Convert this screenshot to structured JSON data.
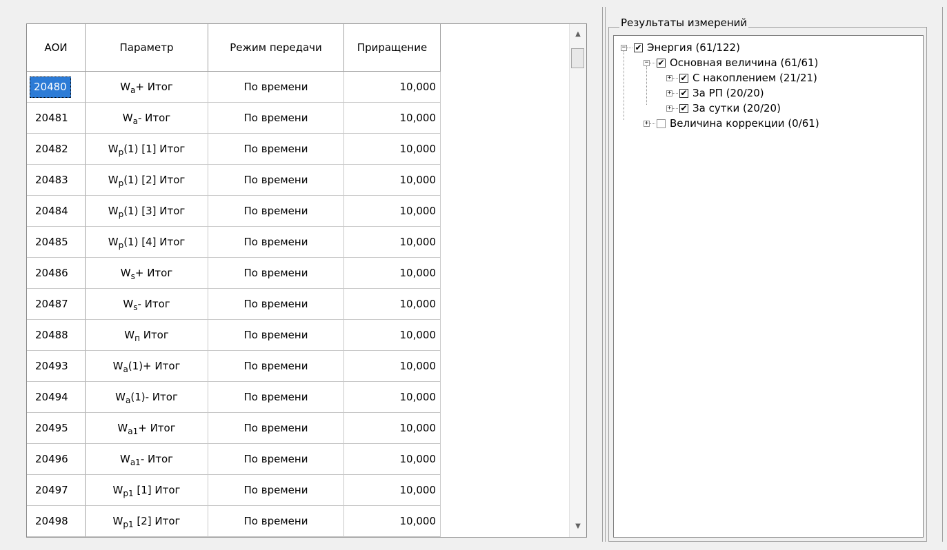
{
  "grid": {
    "headers": {
      "aoi": "АОИ",
      "param": "Параметр",
      "mode": "Режим передачи",
      "inc": "Приращение"
    },
    "rows": [
      {
        "aoi": "20480",
        "param": {
          "base": "W",
          "sub": "a",
          "rest": "+ Итог"
        },
        "mode": "По времени",
        "inc": "10,000",
        "selected": true
      },
      {
        "aoi": "20481",
        "param": {
          "base": "W",
          "sub": "a",
          "rest": "- Итог"
        },
        "mode": "По времени",
        "inc": "10,000"
      },
      {
        "aoi": "20482",
        "param": {
          "base": "W",
          "sub": "p",
          "rest": "(1) [1] Итог"
        },
        "mode": "По времени",
        "inc": "10,000"
      },
      {
        "aoi": "20483",
        "param": {
          "base": "W",
          "sub": "p",
          "rest": "(1) [2] Итог"
        },
        "mode": "По времени",
        "inc": "10,000"
      },
      {
        "aoi": "20484",
        "param": {
          "base": "W",
          "sub": "p",
          "rest": "(1) [3] Итог"
        },
        "mode": "По времени",
        "inc": "10,000"
      },
      {
        "aoi": "20485",
        "param": {
          "base": "W",
          "sub": "p",
          "rest": "(1) [4] Итог"
        },
        "mode": "По времени",
        "inc": "10,000"
      },
      {
        "aoi": "20486",
        "param": {
          "base": "W",
          "sub": "s",
          "rest": "+ Итог"
        },
        "mode": "По времени",
        "inc": "10,000"
      },
      {
        "aoi": "20487",
        "param": {
          "base": "W",
          "sub": "s",
          "rest": "- Итог"
        },
        "mode": "По времени",
        "inc": "10,000"
      },
      {
        "aoi": "20488",
        "param": {
          "base": "W",
          "sub": "п",
          "rest": " Итог"
        },
        "mode": "По времени",
        "inc": "10,000"
      },
      {
        "aoi": "20493",
        "param": {
          "base": "W",
          "sub": "a",
          "rest": "(1)+ Итог"
        },
        "mode": "По времени",
        "inc": "10,000"
      },
      {
        "aoi": "20494",
        "param": {
          "base": "W",
          "sub": "a",
          "rest": "(1)- Итог"
        },
        "mode": "По времени",
        "inc": "10,000"
      },
      {
        "aoi": "20495",
        "param": {
          "base": "W",
          "sub": "a1",
          "rest": "+ Итог"
        },
        "mode": "По времени",
        "inc": "10,000"
      },
      {
        "aoi": "20496",
        "param": {
          "base": "W",
          "sub": "a1",
          "rest": "- Итог"
        },
        "mode": "По времени",
        "inc": "10,000"
      },
      {
        "aoi": "20497",
        "param": {
          "base": "W",
          "sub": "p1",
          "rest": " [1] Итог"
        },
        "mode": "По времени",
        "inc": "10,000"
      },
      {
        "aoi": "20498",
        "param": {
          "base": "W",
          "sub": "p1",
          "rest": " [2] Итог"
        },
        "mode": "По времени",
        "inc": "10,000"
      }
    ]
  },
  "tree": {
    "title": "Результаты измерений",
    "nodes": [
      {
        "label": "Энергия (61/122)",
        "checked": true,
        "expander": "−"
      },
      {
        "label": "Основная величина (61/61)",
        "checked": true,
        "expander": "−"
      },
      {
        "label": "С накоплением (21/21)",
        "checked": true,
        "expander": "+"
      },
      {
        "label": "За РП (20/20)",
        "checked": true,
        "expander": "+"
      },
      {
        "label": "За сутки (20/20)",
        "checked": true,
        "expander": "+"
      },
      {
        "label": "Величина коррекции (0/61)",
        "checked": false,
        "expander": "+"
      }
    ]
  }
}
